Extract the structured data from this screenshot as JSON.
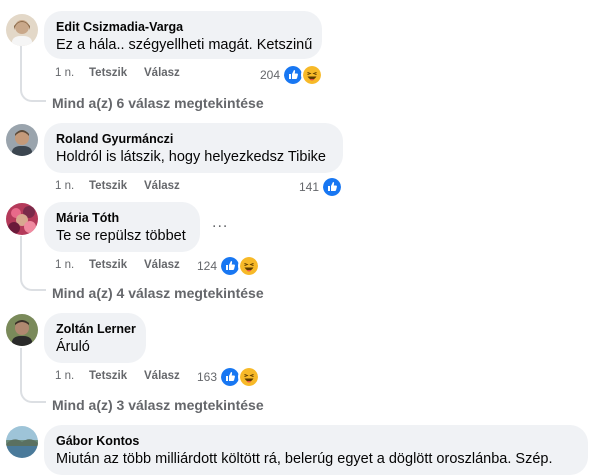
{
  "comments": [
    {
      "author": "Edit Csizmadia-Varga",
      "text": "Ez a hála.. szégyellheti magát. Ketszinű",
      "time": "1 n.",
      "like": "Tetszik",
      "reply": "Válasz",
      "reaction_count": "204",
      "reactions": [
        "like-icon",
        "haha-icon"
      ],
      "view_replies": "Mind a(z) 6 válasz megtekintése"
    },
    {
      "author": "Roland Gyurmánczi",
      "text": "Holdról is látszik, hogy helyezkedsz Tibike",
      "time": "1 n.",
      "like": "Tetszik",
      "reply": "Válasz",
      "reaction_count": "141",
      "reactions": [
        "like-icon"
      ]
    },
    {
      "author": "Mária Tóth",
      "text": "Te se repülsz többet",
      "time": "1 n.",
      "like": "Tetszik",
      "reply": "Válasz",
      "reaction_count": "124",
      "reactions": [
        "like-icon",
        "haha-icon"
      ],
      "more": "...",
      "view_replies": "Mind a(z) 4 válasz megtekintése"
    },
    {
      "author": "Zoltán Lerner",
      "text": "Áruló",
      "time": "1 n.",
      "like": "Tetszik",
      "reply": "Válasz",
      "reaction_count": "163",
      "reactions": [
        "like-icon",
        "haha-icon"
      ],
      "view_replies": "Mind a(z) 3 válasz megtekintése"
    },
    {
      "author": "Gábor Kontos",
      "text": "Miután az több milliárdott költött rá, belerúg egyet a döglött oroszlánba. Szép."
    }
  ],
  "colors": {
    "bubble": "#f0f2f5",
    "secondary_text": "#65676b",
    "like_blue": "#1877f2",
    "haha_yellow": "#f7b928",
    "thread_line": "#dcdfe3"
  }
}
